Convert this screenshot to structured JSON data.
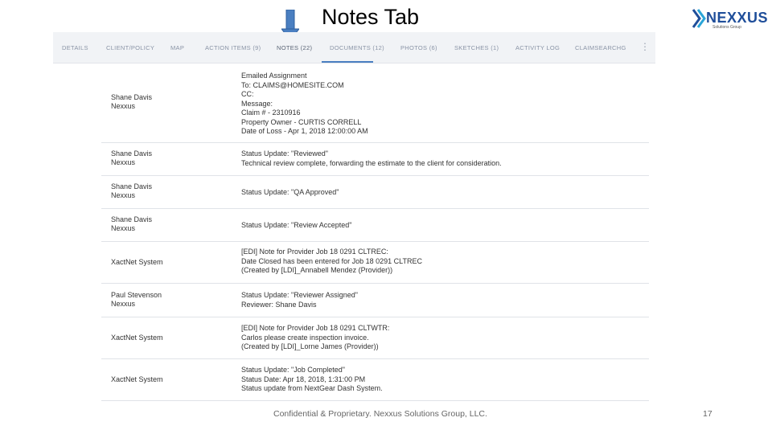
{
  "slide": {
    "title": "Notes Tab",
    "footer": "Confidential & Proprietary.  Nexxus Solutions Group, LLC.",
    "page_number": "17"
  },
  "logo": {
    "brand": "NEXXUS",
    "tagline": "Solutions Group"
  },
  "tabs": [
    {
      "label": "DETAILS"
    },
    {
      "label": "CLIENT/POLICY"
    },
    {
      "label": "MAP"
    },
    {
      "label": "ACTION ITEMS (9)"
    },
    {
      "label": "NOTES (22)"
    },
    {
      "label": "DOCUMENTS (12)"
    },
    {
      "label": "PHOTOS (6)"
    },
    {
      "label": "SKETCHES (1)"
    },
    {
      "label": "ACTIVITY LOG"
    },
    {
      "label": "CLAIMSEARCHG"
    }
  ],
  "active_tab": "NOTES (22)",
  "notes": [
    {
      "author": [
        "Shane Davis",
        "Nexxus"
      ],
      "lines": [
        "Emailed Assignment",
        "To: CLAIMS@HOMESITE.COM",
        "CC:",
        "Message:",
        "Claim # - 2310916",
        "Property Owner - CURTIS CORRELL",
        "Date of Loss - Apr 1, 2018 12:00:00 AM"
      ]
    },
    {
      "author": [
        "Shane Davis",
        "Nexxus"
      ],
      "lines": [
        "Status Update: \"Reviewed\"",
        "Technical review complete, forwarding the estimate to the client for consideration."
      ]
    },
    {
      "author": [
        "Shane Davis",
        "Nexxus"
      ],
      "lines": [
        "Status Update: \"QA Approved\""
      ]
    },
    {
      "author": [
        "Shane Davis",
        "Nexxus"
      ],
      "lines": [
        "Status Update: \"Review Accepted\""
      ]
    },
    {
      "author": [
        "XactNet System"
      ],
      "lines": [
        "[EDI] Note for Provider Job 18 0291 CLTREC:",
        "Date Closed has been entered for Job  18 0291 CLTREC",
        "(Created by [LDI]_Annabell Mendez (Provider))"
      ]
    },
    {
      "author": [
        "Paul Stevenson",
        "Nexxus"
      ],
      "lines": [
        "Status Update: \"Reviewer Assigned\"",
        "Reviewer: Shane Davis"
      ]
    },
    {
      "author": [
        "XactNet System"
      ],
      "lines": [
        "[EDI] Note for Provider Job 18 0291 CLTWTR:",
        "Carlos please create inspection invoice.",
        "(Created by [LDI]_Lorne James (Provider))"
      ]
    },
    {
      "author": [
        "XactNet System"
      ],
      "lines": [
        "Status Update: \"Job Completed\"",
        "Status Date: Apr 18, 2018, 1:31:00 PM",
        "Status update from NextGear Dash System."
      ]
    }
  ]
}
